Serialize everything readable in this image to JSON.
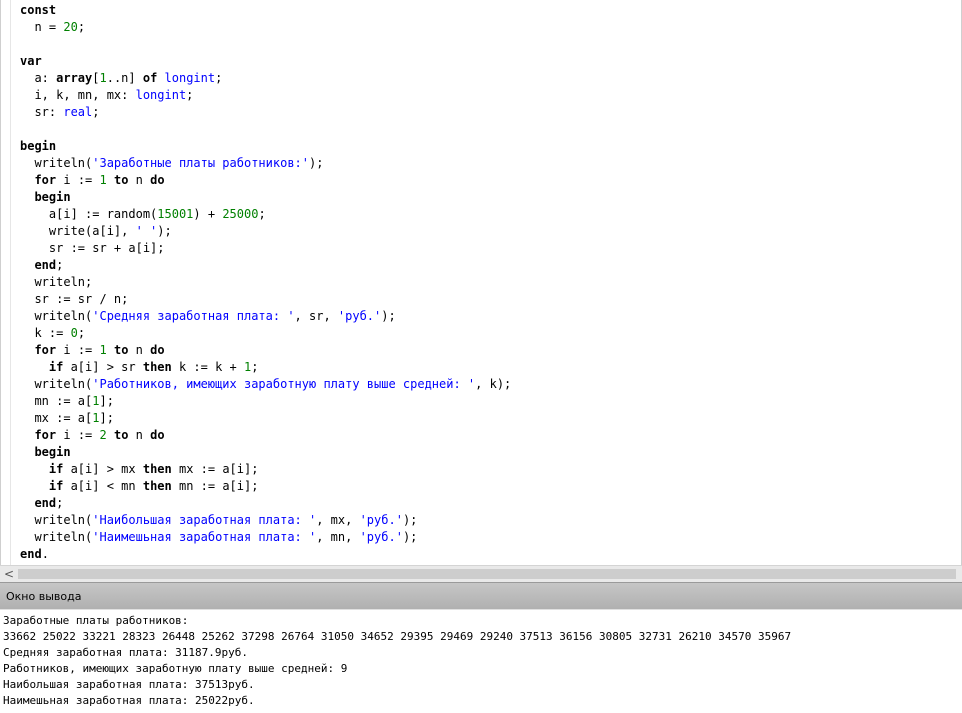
{
  "editor": {
    "lines": [
      [
        [
          "kw",
          "const"
        ]
      ],
      [
        [
          "pl",
          "  n = "
        ],
        [
          "nm",
          "20"
        ],
        [
          "pl",
          ";"
        ]
      ],
      [],
      [
        [
          "kw",
          "var"
        ]
      ],
      [
        [
          "pl",
          "  a: "
        ],
        [
          "kw",
          "array"
        ],
        [
          "pl",
          "["
        ],
        [
          "nm",
          "1"
        ],
        [
          "pl",
          "..n] "
        ],
        [
          "kw",
          "of"
        ],
        [
          "pl",
          " "
        ],
        [
          "ty",
          "longint"
        ],
        [
          "pl",
          ";"
        ]
      ],
      [
        [
          "pl",
          "  i, k, mn, mx: "
        ],
        [
          "ty",
          "longint"
        ],
        [
          "pl",
          ";"
        ]
      ],
      [
        [
          "pl",
          "  sr: "
        ],
        [
          "ty",
          "real"
        ],
        [
          "pl",
          ";"
        ]
      ],
      [],
      [
        [
          "kw",
          "begin"
        ]
      ],
      [
        [
          "pl",
          "  writeln("
        ],
        [
          "st",
          "'Заработные платы работников:'"
        ],
        [
          "pl",
          ");"
        ]
      ],
      [
        [
          "pl",
          "  "
        ],
        [
          "kw",
          "for"
        ],
        [
          "pl",
          " i := "
        ],
        [
          "nm",
          "1"
        ],
        [
          "pl",
          " "
        ],
        [
          "kw",
          "to"
        ],
        [
          "pl",
          " n "
        ],
        [
          "kw",
          "do"
        ]
      ],
      [
        [
          "pl",
          "  "
        ],
        [
          "kw",
          "begin"
        ]
      ],
      [
        [
          "pl",
          "    a[i] := random("
        ],
        [
          "nm",
          "15001"
        ],
        [
          "pl",
          ") + "
        ],
        [
          "nm",
          "25000"
        ],
        [
          "pl",
          ";"
        ]
      ],
      [
        [
          "pl",
          "    write(a[i], "
        ],
        [
          "st",
          "' '"
        ],
        [
          "pl",
          ");"
        ]
      ],
      [
        [
          "pl",
          "    sr := sr + a[i];"
        ]
      ],
      [
        [
          "pl",
          "  "
        ],
        [
          "kw",
          "end"
        ],
        [
          "pl",
          ";"
        ]
      ],
      [
        [
          "pl",
          "  writeln;"
        ]
      ],
      [
        [
          "pl",
          "  sr := sr / n;"
        ]
      ],
      [
        [
          "pl",
          "  writeln("
        ],
        [
          "st",
          "'Средняя заработная плата: '"
        ],
        [
          "pl",
          ", sr, "
        ],
        [
          "st",
          "'руб.'"
        ],
        [
          "pl",
          ");"
        ]
      ],
      [
        [
          "pl",
          "  k := "
        ],
        [
          "nm",
          "0"
        ],
        [
          "pl",
          ";"
        ]
      ],
      [
        [
          "pl",
          "  "
        ],
        [
          "kw",
          "for"
        ],
        [
          "pl",
          " i := "
        ],
        [
          "nm",
          "1"
        ],
        [
          "pl",
          " "
        ],
        [
          "kw",
          "to"
        ],
        [
          "pl",
          " n "
        ],
        [
          "kw",
          "do"
        ]
      ],
      [
        [
          "pl",
          "    "
        ],
        [
          "kw",
          "if"
        ],
        [
          "pl",
          " a[i] > sr "
        ],
        [
          "kw",
          "then"
        ],
        [
          "pl",
          " k := k + "
        ],
        [
          "nm",
          "1"
        ],
        [
          "pl",
          ";"
        ]
      ],
      [
        [
          "pl",
          "  writeln("
        ],
        [
          "st",
          "'Работников, имеющих заработную плату выше средней: '"
        ],
        [
          "pl",
          ", k);"
        ]
      ],
      [
        [
          "pl",
          "  mn := a["
        ],
        [
          "nm",
          "1"
        ],
        [
          "pl",
          "];"
        ]
      ],
      [
        [
          "pl",
          "  mx := a["
        ],
        [
          "nm",
          "1"
        ],
        [
          "pl",
          "];"
        ]
      ],
      [
        [
          "pl",
          "  "
        ],
        [
          "kw",
          "for"
        ],
        [
          "pl",
          " i := "
        ],
        [
          "nm",
          "2"
        ],
        [
          "pl",
          " "
        ],
        [
          "kw",
          "to"
        ],
        [
          "pl",
          " n "
        ],
        [
          "kw",
          "do"
        ]
      ],
      [
        [
          "pl",
          "  "
        ],
        [
          "kw",
          "begin"
        ]
      ],
      [
        [
          "pl",
          "    "
        ],
        [
          "kw",
          "if"
        ],
        [
          "pl",
          " a[i] > mx "
        ],
        [
          "kw",
          "then"
        ],
        [
          "pl",
          " mx := a[i];"
        ]
      ],
      [
        [
          "pl",
          "    "
        ],
        [
          "kw",
          "if"
        ],
        [
          "pl",
          " a[i] < mn "
        ],
        [
          "kw",
          "then"
        ],
        [
          "pl",
          " mn := a[i];"
        ]
      ],
      [
        [
          "pl",
          "  "
        ],
        [
          "kw",
          "end"
        ],
        [
          "pl",
          ";"
        ]
      ],
      [
        [
          "pl",
          "  writeln("
        ],
        [
          "st",
          "'Наибольшая заработная плата: '"
        ],
        [
          "pl",
          ", mx, "
        ],
        [
          "st",
          "'руб.'"
        ],
        [
          "pl",
          ");"
        ]
      ],
      [
        [
          "pl",
          "  writeln("
        ],
        [
          "st",
          "'Наимешьная заработная плата: '"
        ],
        [
          "pl",
          ", mn, "
        ],
        [
          "st",
          "'руб.'"
        ],
        [
          "pl",
          ");"
        ]
      ],
      [
        [
          "kw",
          "end"
        ],
        [
          "pl",
          "."
        ]
      ]
    ]
  },
  "scrollbar": {
    "left_arrow": "<"
  },
  "output": {
    "title": "Окно вывода",
    "lines": [
      "Заработные платы работников:",
      "33662 25022 33221 28323 26448 25262 37298 26764 31050 34652 29395 29469 29240 37513 36156 30805 32731 26210 34570 35967",
      "Средняя заработная плата: 31187.9руб.",
      "Работников, имеющих заработную плату выше средней: 9",
      "Наибольшая заработная плата: 37513руб.",
      "Наимешьная заработная плата: 25022руб."
    ]
  }
}
